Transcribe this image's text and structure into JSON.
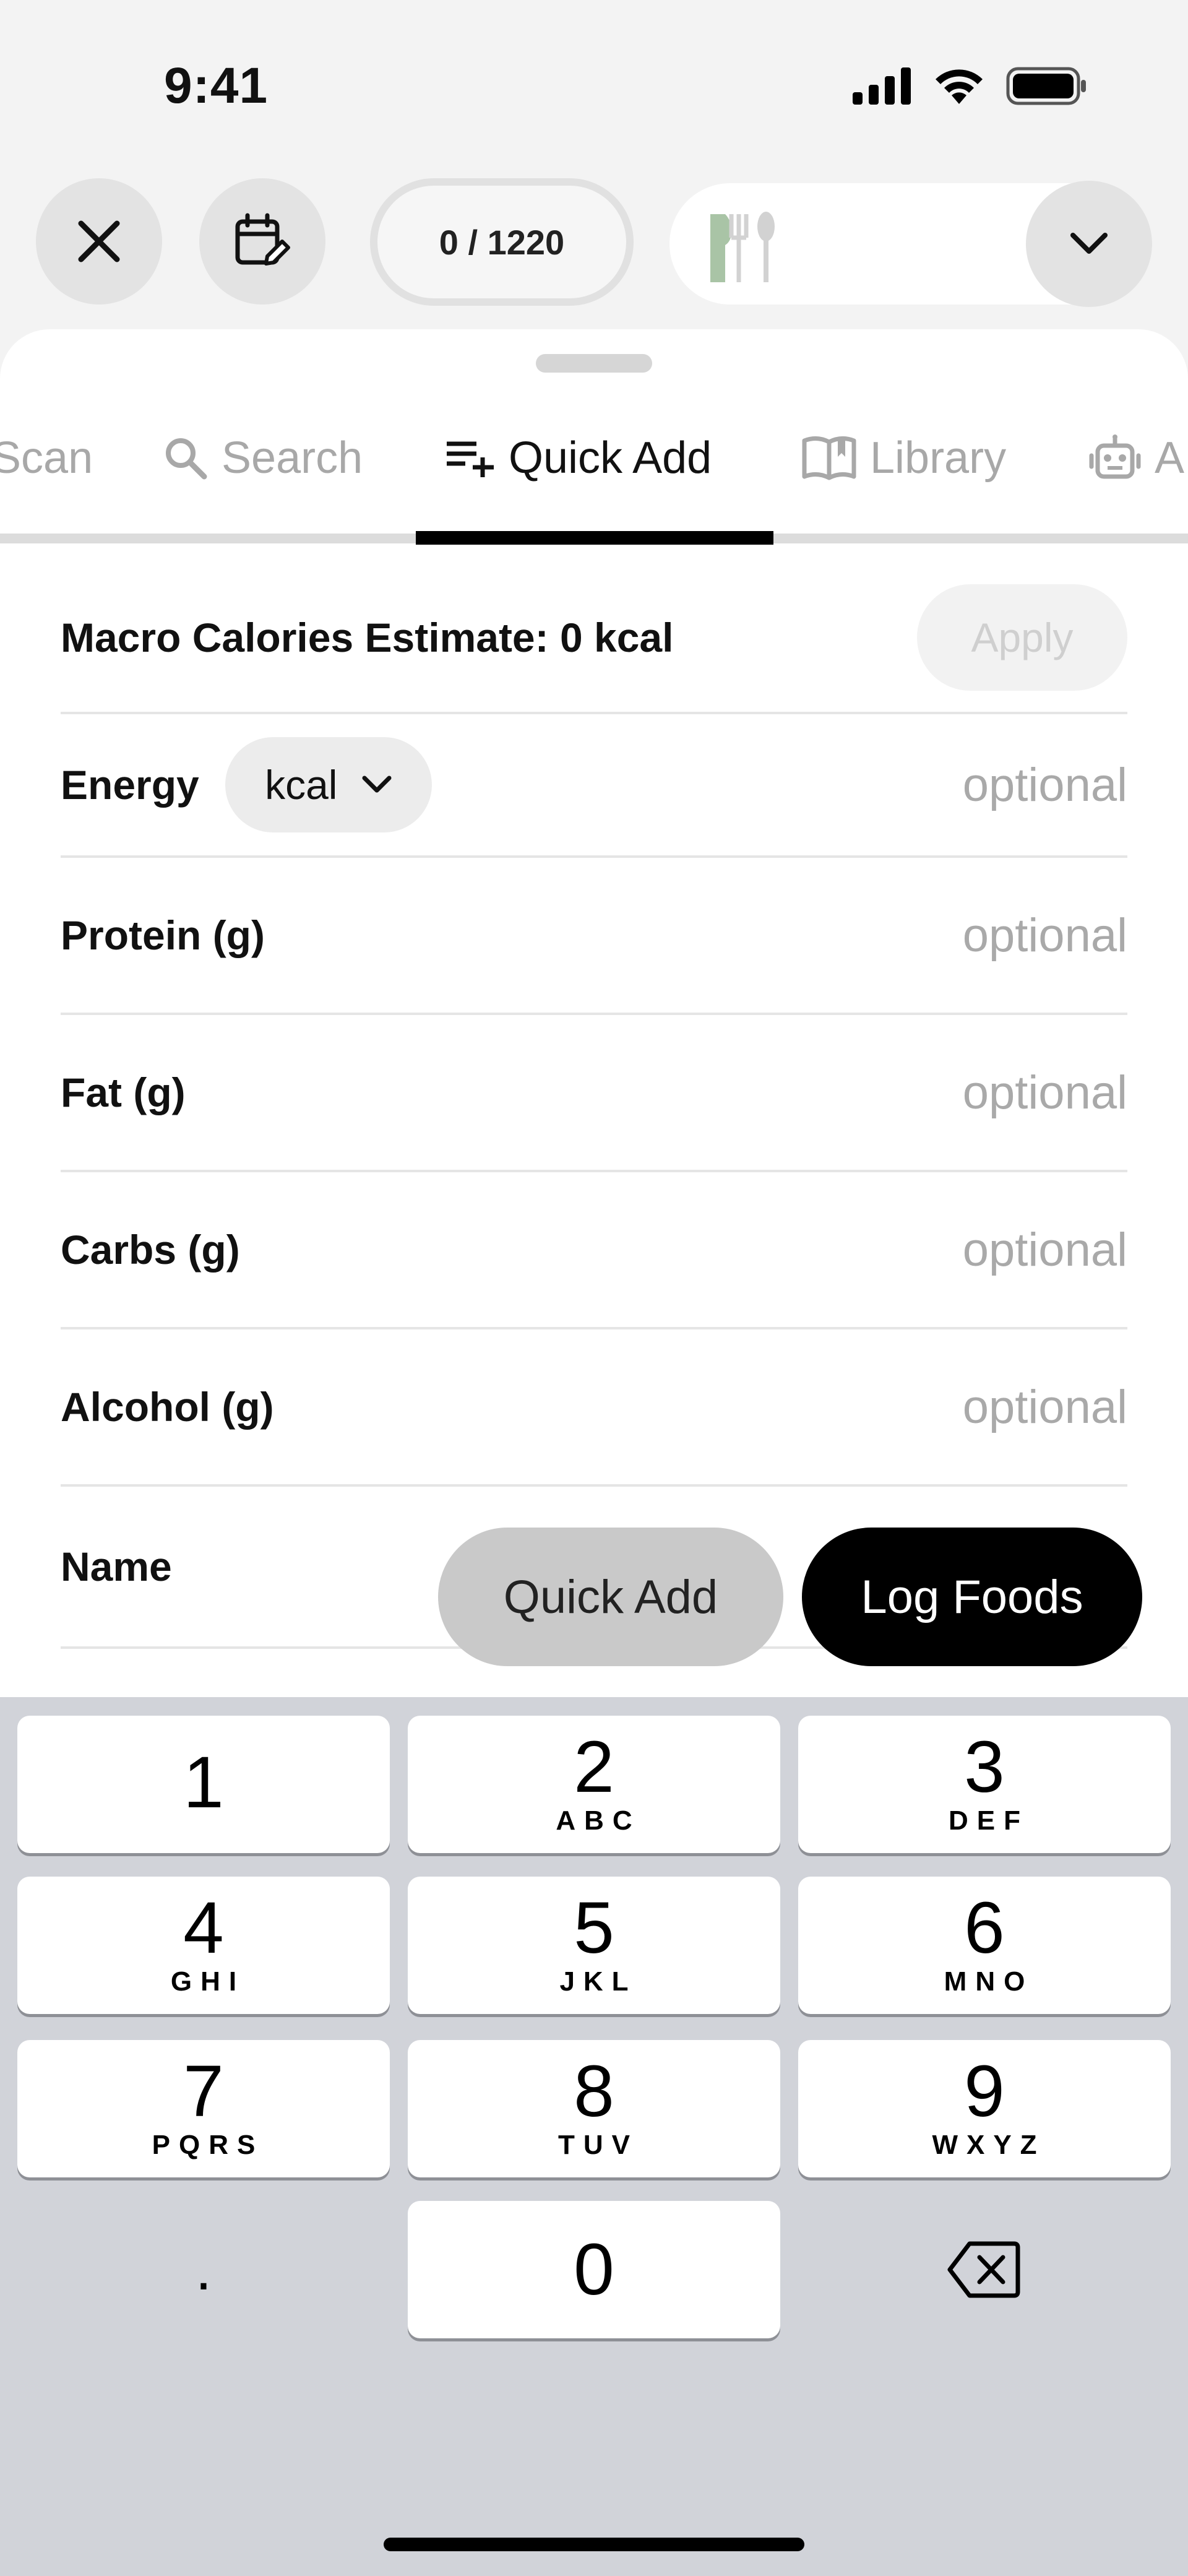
{
  "status_bar": {
    "time": "9:41"
  },
  "toolbar": {
    "progress": "0 / 1220"
  },
  "tabs": [
    {
      "label": "Scan"
    },
    {
      "label": "Search"
    },
    {
      "label": "Quick Add"
    },
    {
      "label": "Library"
    },
    {
      "label": "A"
    }
  ],
  "active_tab": "Quick Add",
  "form": {
    "estimate_label": "Macro Calories Estimate: 0 kcal",
    "apply_label": "Apply",
    "energy_label": "Energy",
    "energy_unit": "kcal",
    "protein_label": "Protein (g)",
    "fat_label": "Fat (g)",
    "carbs_label": "Carbs (g)",
    "alcohol_label": "Alcohol (g)",
    "name_label": "Name",
    "placeholder": "optional"
  },
  "actions": {
    "quick_add": "Quick Add",
    "log_foods": "Log Foods"
  },
  "keyboard": {
    "keys": [
      {
        "num": "1",
        "letters": ""
      },
      {
        "num": "2",
        "letters": "ABC"
      },
      {
        "num": "3",
        "letters": "DEF"
      },
      {
        "num": "4",
        "letters": "GHI"
      },
      {
        "num": "5",
        "letters": "JKL"
      },
      {
        "num": "6",
        "letters": "MNO"
      },
      {
        "num": "7",
        "letters": "PQRS"
      },
      {
        "num": "8",
        "letters": "TUV"
      },
      {
        "num": "9",
        "letters": "WXYZ"
      },
      {
        "num": "0",
        "letters": ""
      }
    ],
    "decimal": "."
  },
  "icons": {
    "close": "close-icon",
    "calendar": "calendar-edit-icon",
    "meal": "fork-spoon-icon",
    "dropdown": "chevron-down-icon",
    "search": "search-icon",
    "quick_add": "playlist-add-icon",
    "library": "book-icon",
    "ai": "robot-icon",
    "backspace": "backspace-icon"
  },
  "colors": {
    "accent": "#000000",
    "meal_icon_green": "#a9c4a6"
  }
}
